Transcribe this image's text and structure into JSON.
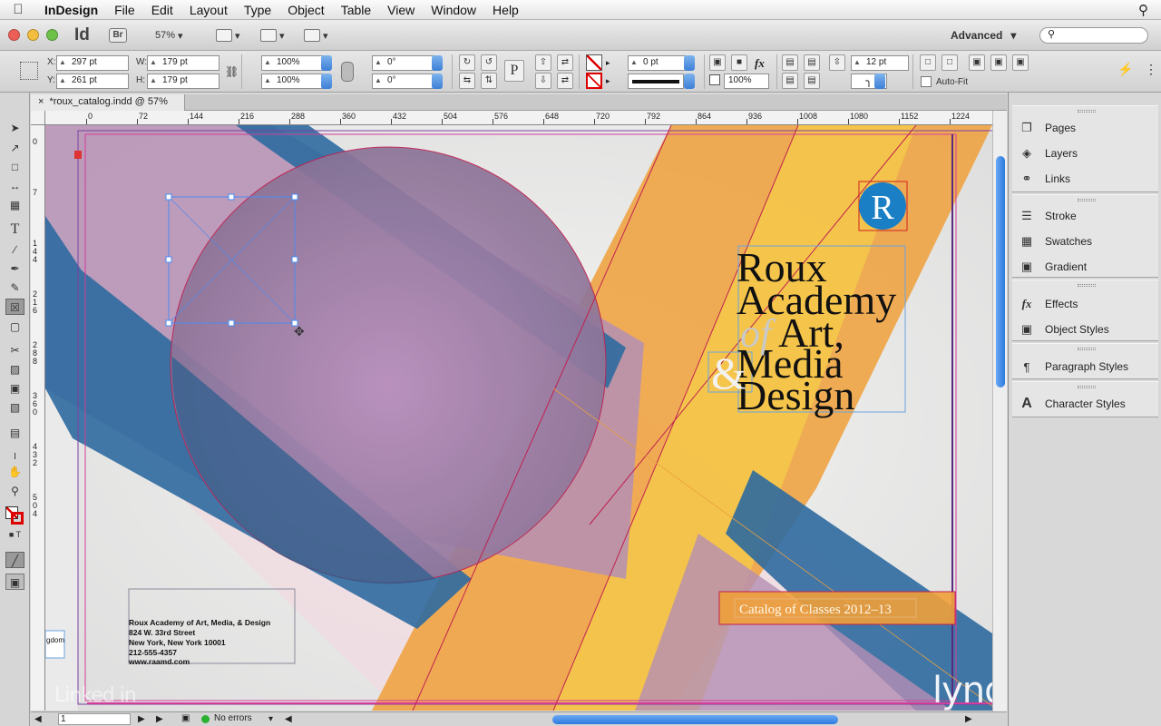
{
  "menubar": {
    "app_name": "InDesign",
    "items": [
      "File",
      "Edit",
      "Layout",
      "Type",
      "Object",
      "Table",
      "View",
      "Window",
      "Help"
    ]
  },
  "appbar": {
    "id_logo": "Id",
    "br_logo": "Br",
    "zoom": "57%",
    "workspace": "Advanced"
  },
  "control": {
    "x": "297 pt",
    "y": "261 pt",
    "w": "179 pt",
    "h": "179 pt",
    "scale_x": "100%",
    "scale_y": "100%",
    "rotate": "0°",
    "shear": "0°",
    "stroke_weight": "0 pt",
    "opacity": "100%",
    "gutter": "12 pt",
    "autofit": "Auto-Fit"
  },
  "document": {
    "tab_title": "*roux_catalog.indd @ 57%"
  },
  "ruler": {
    "h_marks": [
      "0",
      "72",
      "144",
      "216",
      "288",
      "360",
      "432",
      "504",
      "576",
      "648",
      "720",
      "792",
      "864",
      "936",
      "1008",
      "1080",
      "1152",
      "1224"
    ],
    "v_marks": [
      "0",
      "7",
      "1 4 4",
      "2 1 6",
      "2 8 8",
      "3 6 0",
      "4 3 2",
      "5 0 4"
    ]
  },
  "artwork": {
    "logo_letter": "R",
    "title_lines": [
      "Roux",
      "Academy",
      "Art,",
      "Media",
      "Design"
    ],
    "title_of": "of",
    "ampersand": "&",
    "catalog_banner": "Catalog of Classes 2012–13",
    "address_lines": [
      "Roux Academy of Art, Media, & Design",
      "824 W. 33rd Street",
      "New York, New York 10001",
      "212-555-4357",
      "www.raamd.com"
    ],
    "slug_text": "gdom"
  },
  "panels": [
    {
      "label": "Pages",
      "icon": "pages-icon"
    },
    {
      "label": "Layers",
      "icon": "layers-icon"
    },
    {
      "label": "Links",
      "icon": "links-icon"
    },
    {
      "label": "Stroke",
      "icon": "stroke-icon"
    },
    {
      "label": "Swatches",
      "icon": "swatches-icon"
    },
    {
      "label": "Gradient",
      "icon": "gradient-icon"
    },
    {
      "label": "Effects",
      "icon": "effects-icon"
    },
    {
      "label": "Object Styles",
      "icon": "object-styles-icon"
    },
    {
      "label": "Paragraph Styles",
      "icon": "paragraph-styles-icon"
    },
    {
      "label": "Character Styles",
      "icon": "character-styles-icon"
    }
  ],
  "status": {
    "page": "1",
    "preflight": "No errors"
  },
  "watermark": {
    "lynda": "lynda.com",
    "linkedin": "Linked in"
  },
  "colors": {
    "orange": "#f0a03a",
    "yellow": "#f5c84a",
    "blue": "#2e6aa0",
    "purple": "#b48fb4",
    "pink": "#f2d3dc",
    "selection": "#4a8cf0",
    "guide_magenta": "#d53c9a"
  }
}
